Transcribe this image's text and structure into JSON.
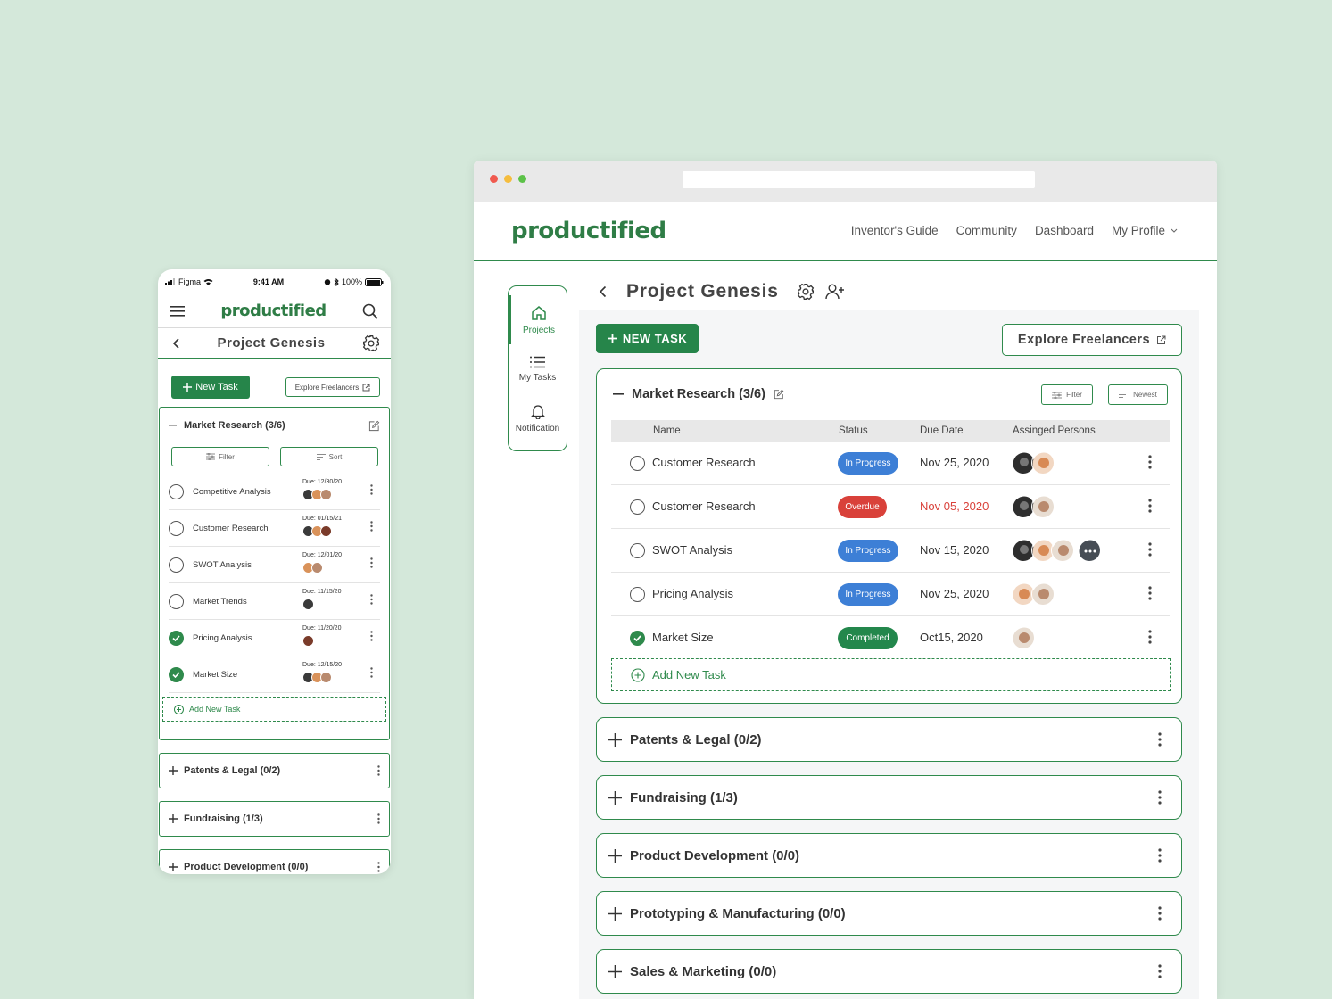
{
  "phone": {
    "status": {
      "carrier": "Figma",
      "time": "9:41 AM",
      "battery": "100%"
    },
    "brand": "productified",
    "project_title": "Project Genesis",
    "new_task_label": "New Task",
    "explore_label": "Explore Freelancers",
    "section": {
      "title": "Market Research (3/6)",
      "filter_label": "Filter",
      "sort_label": "Sort"
    },
    "tasks": [
      {
        "name": "Competitive Analysis",
        "due": "Due: 12/30/20",
        "completed": false
      },
      {
        "name": "Customer Research",
        "due": "Due: 01/15/21",
        "completed": false
      },
      {
        "name": "SWOT Analysis",
        "due": "Due: 12/01/20",
        "completed": false
      },
      {
        "name": "Market Trends",
        "due": "Due: 11/15/20",
        "completed": false
      },
      {
        "name": "Pricing Analysis",
        "due": "Due: 11/20/20",
        "completed": true
      },
      {
        "name": "Market Size",
        "due": "Due: 12/15/20",
        "completed": true
      }
    ],
    "add_task_label": "Add New Task",
    "sections": [
      "Patents & Legal (0/2)",
      "Fundraising (1/3)",
      "Product Development (0/0)"
    ]
  },
  "browser": {
    "brand": "productified",
    "nav_links": [
      "Inventor's Guide",
      "Community",
      "Dashboard",
      "My Profile"
    ],
    "sidebar": [
      {
        "label": "Projects",
        "icon": "home-icon",
        "active": true
      },
      {
        "label": "My Tasks",
        "icon": "list-icon",
        "active": false
      },
      {
        "label": "Notification",
        "icon": "bell-icon",
        "active": false
      }
    ],
    "project_title": "Project Genesis",
    "new_task_label": "NEW TASK",
    "explore_label": "Explore Freelancers",
    "section": {
      "title": "Market Research (3/6)",
      "filter_label": "Filter",
      "sort_label": "Newest",
      "columns": [
        "Name",
        "Status",
        "Due Date",
        "Assinged Persons"
      ]
    },
    "tasks": [
      {
        "name": "Customer Research",
        "status": "In Progress",
        "status_color": "#3d7fd6",
        "due": "Nov 25, 2020",
        "overdue": false,
        "completed": false
      },
      {
        "name": "Customer Research",
        "status": "Overdue",
        "status_color": "#d9413a",
        "due": "Nov 05, 2020",
        "overdue": true,
        "completed": false
      },
      {
        "name": "SWOT Analysis",
        "status": "In Progress",
        "status_color": "#3d7fd6",
        "due": "Nov 15, 2020",
        "overdue": false,
        "completed": false
      },
      {
        "name": "Pricing Analysis",
        "status": "In Progress",
        "status_color": "#3d7fd6",
        "due": "Nov 25, 2020",
        "overdue": false,
        "completed": false
      },
      {
        "name": "Market Size",
        "status": "Completed",
        "status_color": "#23874c",
        "due": "Oct15, 2020",
        "overdue": false,
        "completed": true
      }
    ],
    "add_task_label": "Add New Task",
    "sections": [
      "Patents & Legal (0/2)",
      "Fundraising (1/3)",
      "Product Development (0/0)",
      "Prototyping & Manufacturing (0/0)",
      "Sales & Marketing (0/0)"
    ]
  },
  "colors": {
    "accent": "#2f8a4c",
    "background": "#d4e8da",
    "overdue_text": "#d9413a"
  }
}
